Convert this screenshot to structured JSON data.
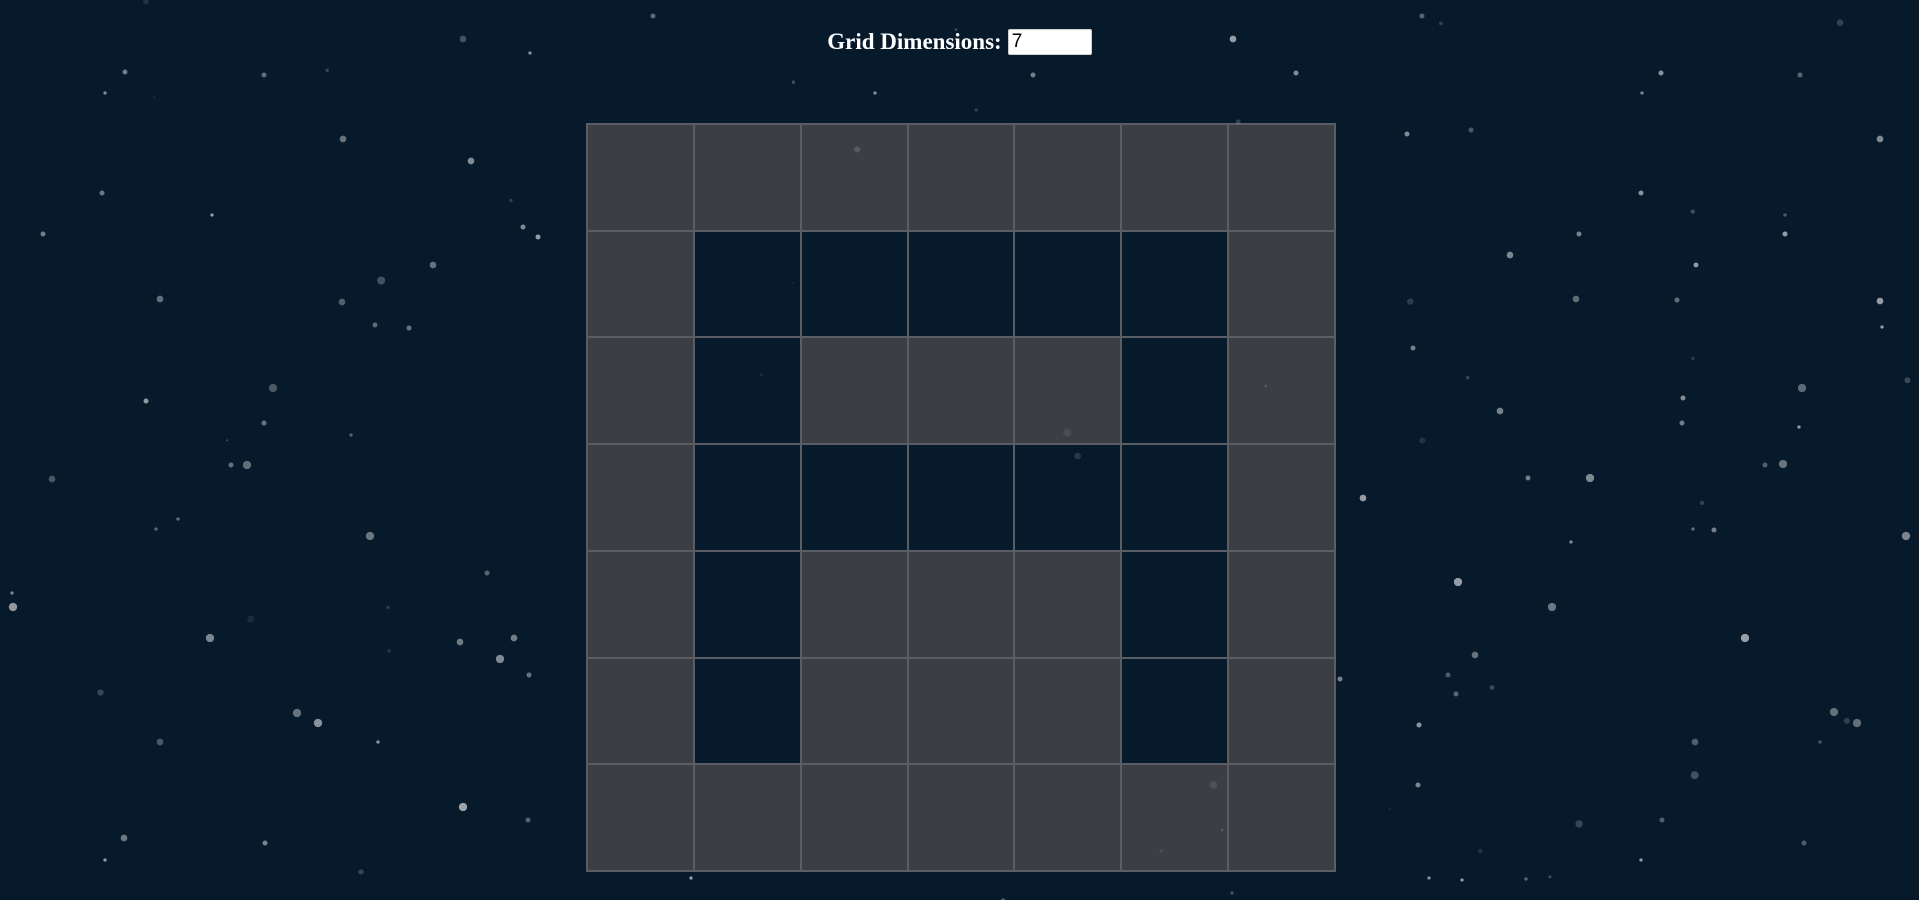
{
  "controls": {
    "label": "Grid Dimensions:",
    "value": "7"
  },
  "grid": {
    "size": 7,
    "rows": [
      [
        1,
        1,
        1,
        1,
        1,
        1,
        1
      ],
      [
        1,
        0,
        0,
        0,
        0,
        0,
        1
      ],
      [
        1,
        0,
        1,
        1,
        1,
        0,
        1
      ],
      [
        1,
        0,
        0,
        0,
        0,
        0,
        1
      ],
      [
        1,
        0,
        1,
        1,
        1,
        0,
        1
      ],
      [
        1,
        0,
        1,
        1,
        1,
        0,
        1
      ],
      [
        1,
        1,
        1,
        1,
        1,
        1,
        1
      ]
    ]
  },
  "colors": {
    "background": "#061a2b",
    "filled_cell": "#3c3e43",
    "empty_cell": "#061a2b",
    "cell_border": "#5a5d63",
    "star": "#b8bcc0"
  }
}
